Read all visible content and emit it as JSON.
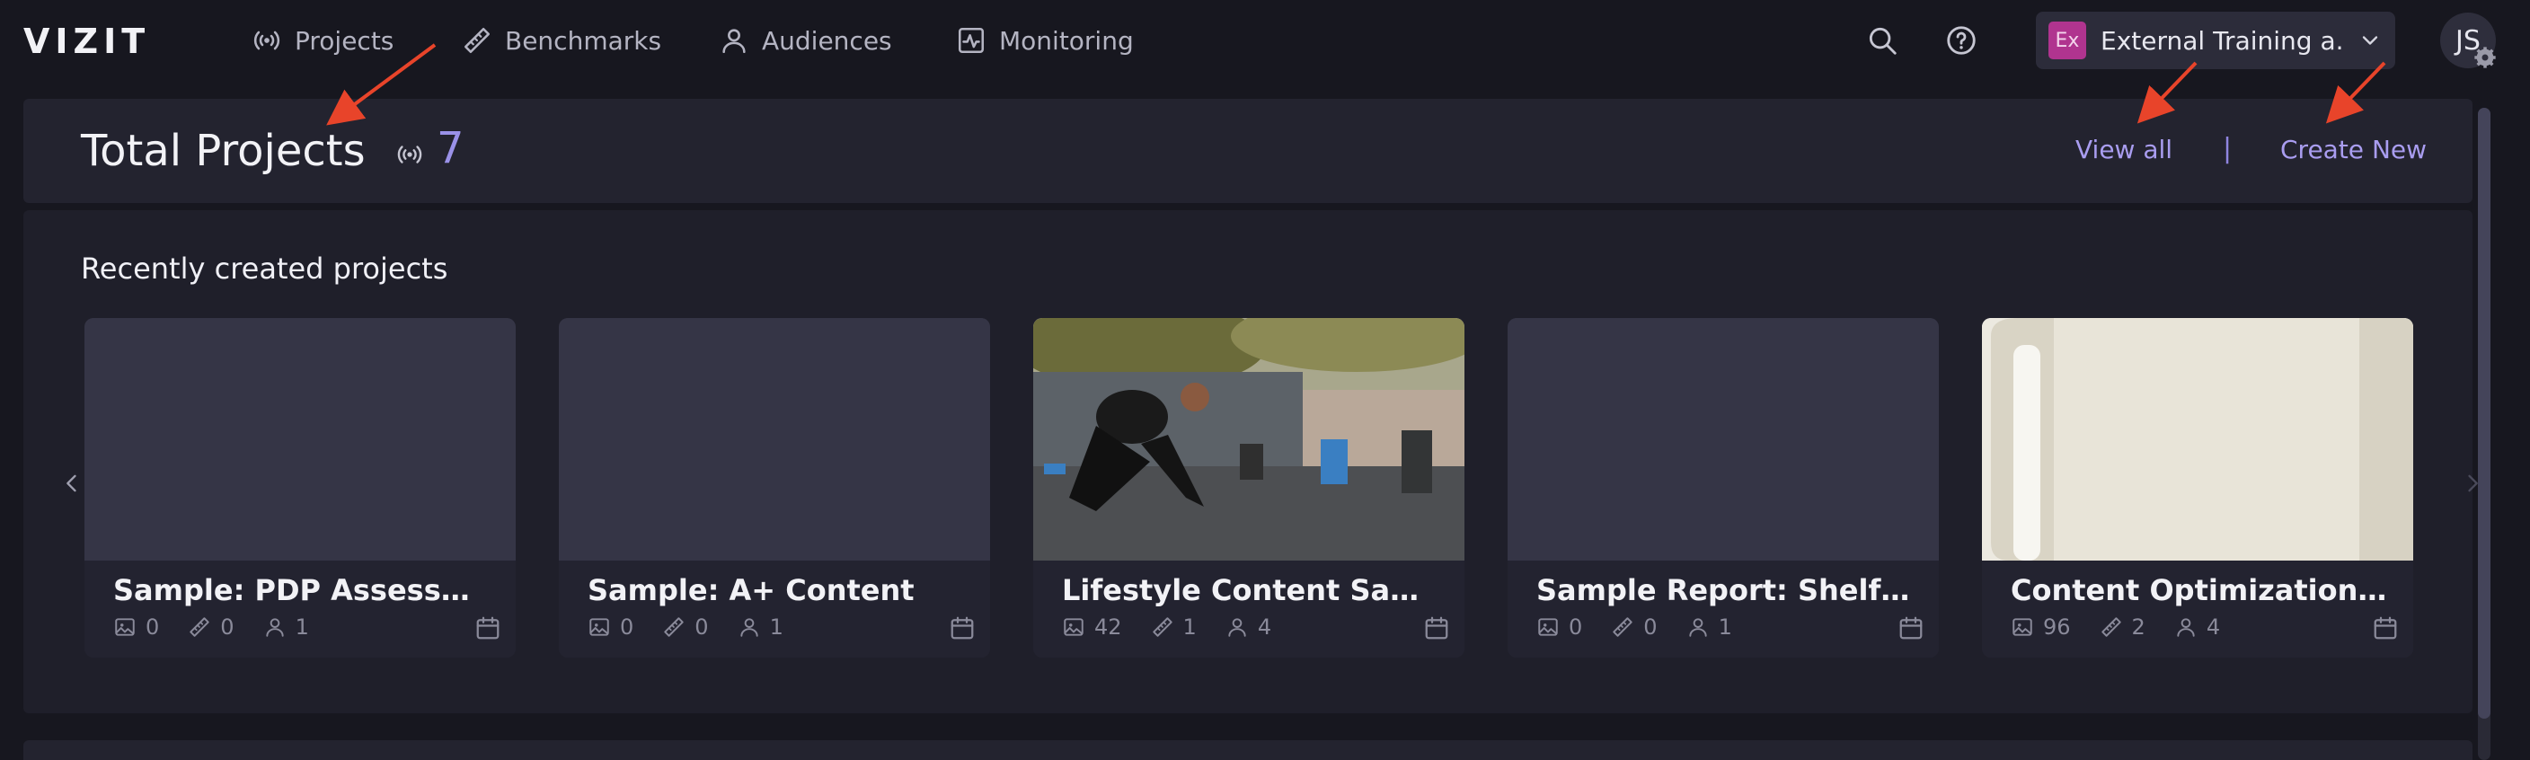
{
  "logo": "VIZIT",
  "nav": {
    "projects": "Projects",
    "benchmarks": "Benchmarks",
    "audiences": "Audiences",
    "monitoring": "Monitoring"
  },
  "org": {
    "badge": "Ex",
    "name": "External Training a..."
  },
  "user": {
    "initials": "JS"
  },
  "header": {
    "title": "Total Projects",
    "count": "7",
    "view_all": "View all",
    "divider": "|",
    "create_new": "Create New"
  },
  "recent": {
    "title": "Recently created projects",
    "projects": [
      {
        "name": "Sample: PDP Assessment",
        "images": "0",
        "benchmarks": "0",
        "audiences": "1",
        "thumb": "empty"
      },
      {
        "name": "Sample: A+ Content",
        "images": "0",
        "benchmarks": "0",
        "audiences": "1",
        "thumb": "empty"
      },
      {
        "name": "Lifestyle Content Sample ...",
        "images": "42",
        "benchmarks": "1",
        "audiences": "4",
        "thumb": "photo-athlete"
      },
      {
        "name": "Sample Report: Shelf Tests",
        "images": "0",
        "benchmarks": "0",
        "audiences": "1",
        "thumb": "empty"
      },
      {
        "name": "Content Optimization Sam...",
        "images": "96",
        "benchmarks": "2",
        "audiences": "4",
        "thumb": "photo-tumbler"
      }
    ]
  },
  "colors": {
    "background": "#17171f",
    "card": "#23232f",
    "accent": "#a99df0",
    "org_badge": "#b0348f",
    "annotation_arrow": "#e8442a"
  }
}
